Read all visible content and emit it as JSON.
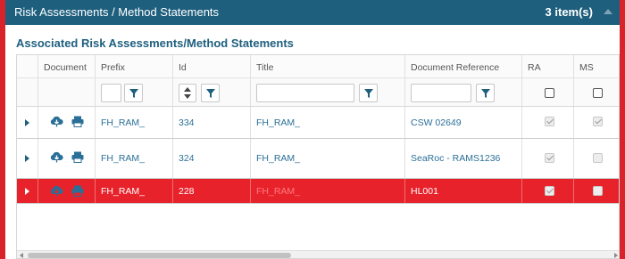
{
  "panel": {
    "title": "Risk Assessments / Method Statements",
    "count": "3 item(s)"
  },
  "section": {
    "title": "Associated Risk Assessments/Method Statements"
  },
  "columns": {
    "document": "Document",
    "prefix": "Prefix",
    "id": "Id",
    "title": "Title",
    "doc_ref": "Document Reference",
    "ra": "RA",
    "ms": "MS"
  },
  "rows": [
    {
      "prefix": "FH_RAM_",
      "id": "334",
      "title": "FH_RAM_",
      "doc_ref": "CSW 02649",
      "ra": true,
      "ms": true
    },
    {
      "prefix": "FH_RAM_",
      "id": "324",
      "title": "FH_RAM_",
      "doc_ref": "SeaRoc - RAMS1236",
      "ra": true,
      "ms": false
    },
    {
      "prefix": "FH_RAM_",
      "id": "228",
      "title": "FH_RAM_",
      "doc_ref": "HL001",
      "ra": true,
      "ms": false
    }
  ],
  "icons": {
    "expand": "expand-row-icon",
    "download": "cloud-download-icon",
    "print": "print-icon",
    "filter": "filter-icon"
  },
  "colors": {
    "header_bg": "#1e5f7e",
    "accent_red": "#e8222b",
    "link_blue": "#2a6f97",
    "section_title": "#1e5f7e"
  }
}
